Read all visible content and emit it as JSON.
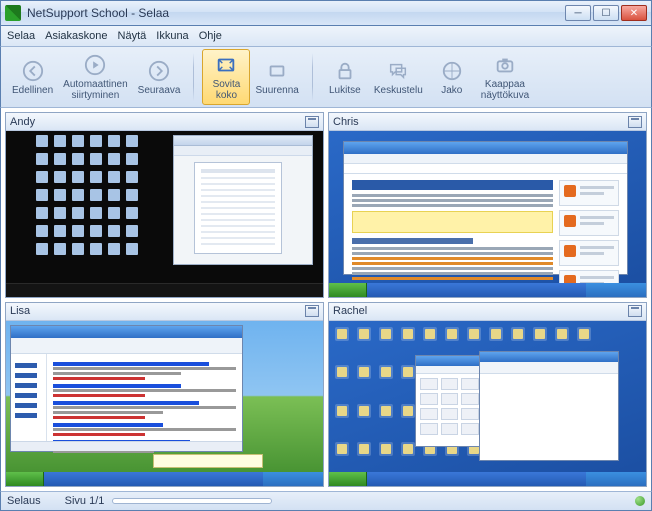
{
  "window": {
    "title": "NetSupport School - Selaa"
  },
  "menu": {
    "items": [
      "Selaa",
      "Asiakaskone",
      "Näytä",
      "Ikkuna",
      "Ohje"
    ]
  },
  "toolbar": {
    "prev": "Edellinen",
    "auto": "Automaattinen\nsiirtyminen",
    "next": "Seuraava",
    "fit": "Sovita\nkoko",
    "enlarge": "Suurenna",
    "lock": "Lukitse",
    "chat": "Keskustelu",
    "share": "Jako",
    "capture": "Kaappaa\nnäyttökuva"
  },
  "students": {
    "a": {
      "name": "Andy"
    },
    "b": {
      "name": "Chris"
    },
    "c": {
      "name": "Lisa"
    },
    "d": {
      "name": "Rachel"
    }
  },
  "status": {
    "mode": "Selaus",
    "page": "Sivu 1/1"
  }
}
